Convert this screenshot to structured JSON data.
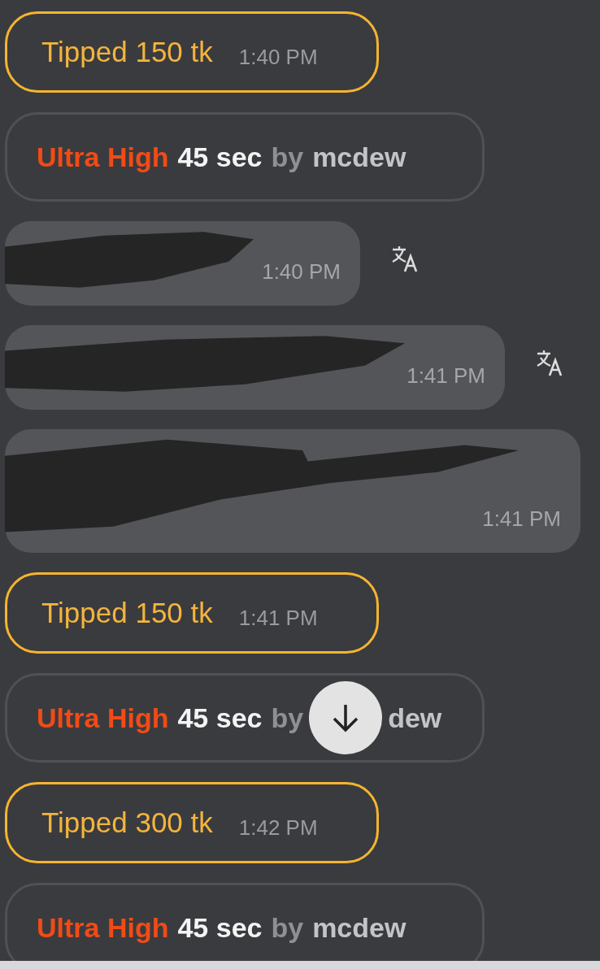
{
  "messages": [
    {
      "kind": "tip",
      "text": "Tipped 150 tk",
      "time": "1:40 PM"
    },
    {
      "kind": "level",
      "level_name": "Ultra High",
      "duration": "45 sec",
      "by": "by",
      "user": "mcdew"
    },
    {
      "kind": "redacted",
      "time": "1:40 PM",
      "translate": true
    },
    {
      "kind": "redacted",
      "time": "1:41 PM",
      "translate": true
    },
    {
      "kind": "redacted",
      "time": "1:41 PM",
      "translate": false
    },
    {
      "kind": "tip",
      "text": "Tipped 150 tk",
      "time": "1:41 PM"
    },
    {
      "kind": "level",
      "level_name": "Ultra High",
      "duration": "45 sec",
      "by": "by",
      "user": "dew",
      "scroll_button": true
    },
    {
      "kind": "tip",
      "text": "Tipped 300 tk",
      "time": "1:42 PM"
    },
    {
      "kind": "level",
      "level_name": "Ultra High",
      "duration": "45 sec",
      "by": "by",
      "user": "mcdew"
    }
  ]
}
